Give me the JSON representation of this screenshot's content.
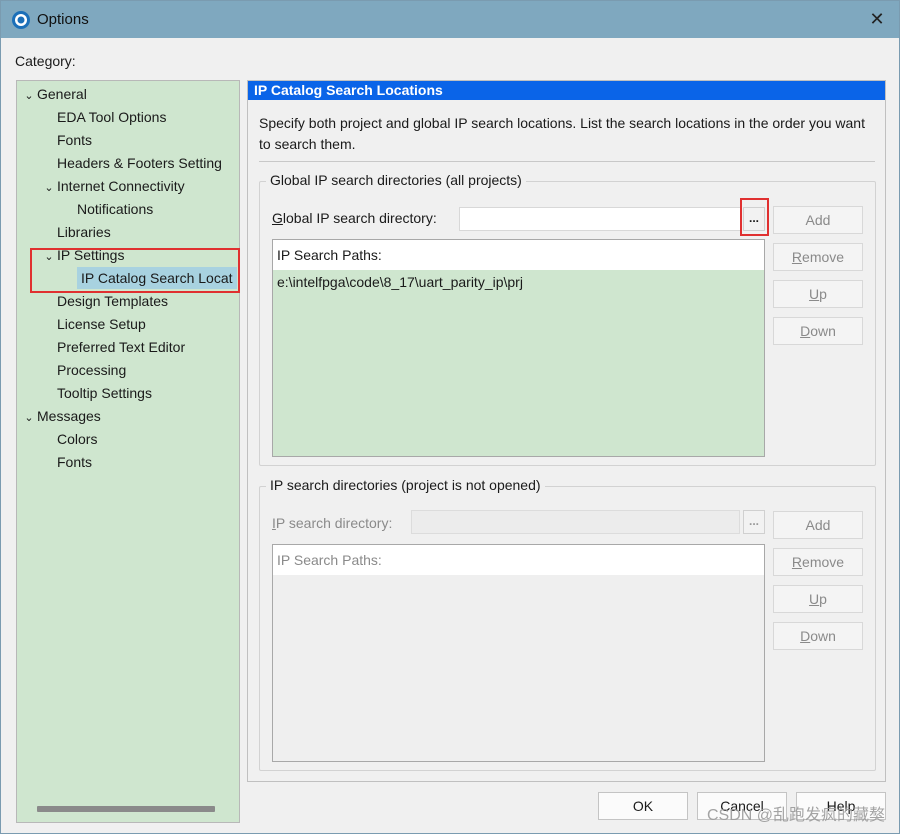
{
  "window": {
    "title": "Options",
    "close_glyph": "✕"
  },
  "category_label": "Category:",
  "tree": [
    {
      "label": "General",
      "indent": 0,
      "expander": "v"
    },
    {
      "label": "EDA Tool Options",
      "indent": 1
    },
    {
      "label": "Fonts",
      "indent": 1
    },
    {
      "label": "Headers & Footers Setting",
      "indent": 1
    },
    {
      "label": "Internet Connectivity",
      "indent": 1,
      "expander": "v"
    },
    {
      "label": "Notifications",
      "indent": 2
    },
    {
      "label": "Libraries",
      "indent": 1
    },
    {
      "label": "IP Settings",
      "indent": 1,
      "expander": "v"
    },
    {
      "label": "IP Catalog Search Locat",
      "indent": 2,
      "selected": true
    },
    {
      "label": "Design Templates",
      "indent": 1
    },
    {
      "label": "License Setup",
      "indent": 1
    },
    {
      "label": "Preferred Text Editor",
      "indent": 1
    },
    {
      "label": "Processing",
      "indent": 1
    },
    {
      "label": "Tooltip Settings",
      "indent": 1
    },
    {
      "label": "Messages",
      "indent": 0,
      "expander": "v"
    },
    {
      "label": "Colors",
      "indent": 1
    },
    {
      "label": "Fonts",
      "indent": 1
    }
  ],
  "panel": {
    "header": "IP Catalog Search Locations",
    "description": "Specify both project and global IP search locations. List the search locations in the order you want to search them.",
    "global_group": {
      "title": "Global IP search directories (all projects)",
      "dir_label": "Global IP search directory:",
      "dir_value": "",
      "browse": "...",
      "list_header": "IP Search Paths:",
      "paths": [
        "e:\\intelfpga\\code\\8_17\\uart_parity_ip\\prj"
      ],
      "buttons": {
        "add": "Add",
        "remove": "Remove",
        "up": "Up",
        "down": "Down"
      }
    },
    "project_group": {
      "title": "IP search directories (project is not opened)",
      "dir_label": "IP search directory:",
      "dir_value": "",
      "browse": "...",
      "list_header": "IP Search Paths:",
      "buttons": {
        "add": "Add",
        "remove": "Remove",
        "up": "Up",
        "down": "Down"
      }
    }
  },
  "footer": {
    "ok": "OK",
    "cancel": "Cancel",
    "help": "Help"
  },
  "watermark": "CSDN @乱跑发疯的藏獒",
  "colors": {
    "tree_bg": "#cfe6cf",
    "header_bg": "#0a64e8",
    "highlight": "#e03030",
    "selected": "#a8d2e0"
  }
}
